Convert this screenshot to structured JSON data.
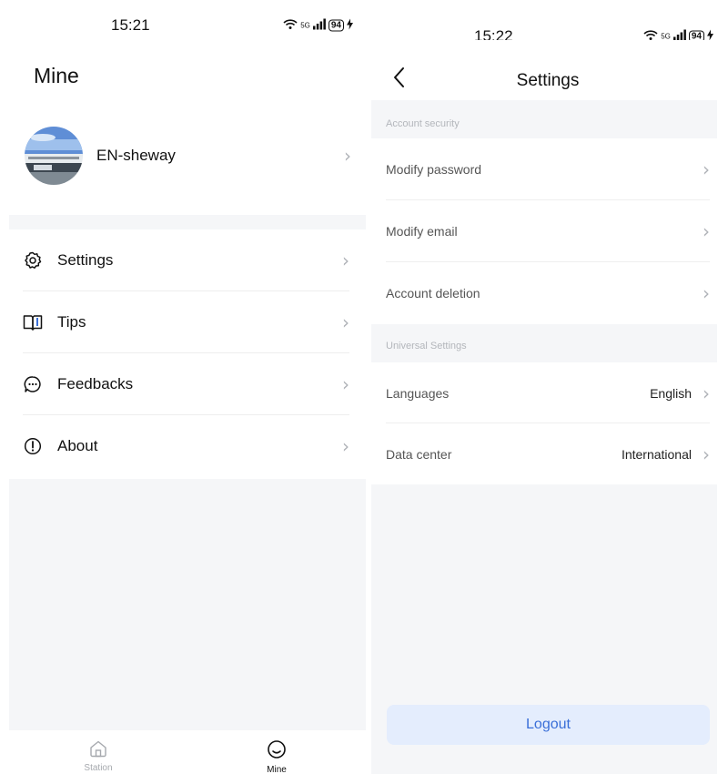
{
  "left_screen": {
    "status": {
      "time": "15:21",
      "network": "5G",
      "battery": "94"
    },
    "title": "Mine",
    "profile": {
      "name": "EN-sheway"
    },
    "menu": [
      {
        "label": "Settings",
        "icon": "gear-icon"
      },
      {
        "label": "Tips",
        "icon": "book-icon"
      },
      {
        "label": "Feedbacks",
        "icon": "chat-bubble-icon"
      },
      {
        "label": "About",
        "icon": "info-exclamation-icon"
      }
    ],
    "tabbar": [
      {
        "label": "Station",
        "icon": "home-icon",
        "active": false
      },
      {
        "label": "Mine",
        "icon": "smile-icon",
        "active": true
      }
    ]
  },
  "right_screen": {
    "status": {
      "time": "15:22",
      "network": "5G",
      "battery": "94"
    },
    "title": "Settings",
    "sections": [
      {
        "header": "Account security",
        "rows": [
          {
            "label": "Modify password",
            "value": ""
          },
          {
            "label": "Modify email",
            "value": ""
          },
          {
            "label": "Account deletion",
            "value": ""
          }
        ]
      },
      {
        "header": "Universal Settings",
        "rows": [
          {
            "label": "Languages",
            "value": "English"
          },
          {
            "label": "Data center",
            "value": "International"
          }
        ]
      }
    ],
    "logout_label": "Logout"
  },
  "colors": {
    "accent": "#3a6fd8",
    "logout_bg": "#e4edfd",
    "page_bg": "#f5f6f8",
    "chevron": "#b0b3b8"
  }
}
